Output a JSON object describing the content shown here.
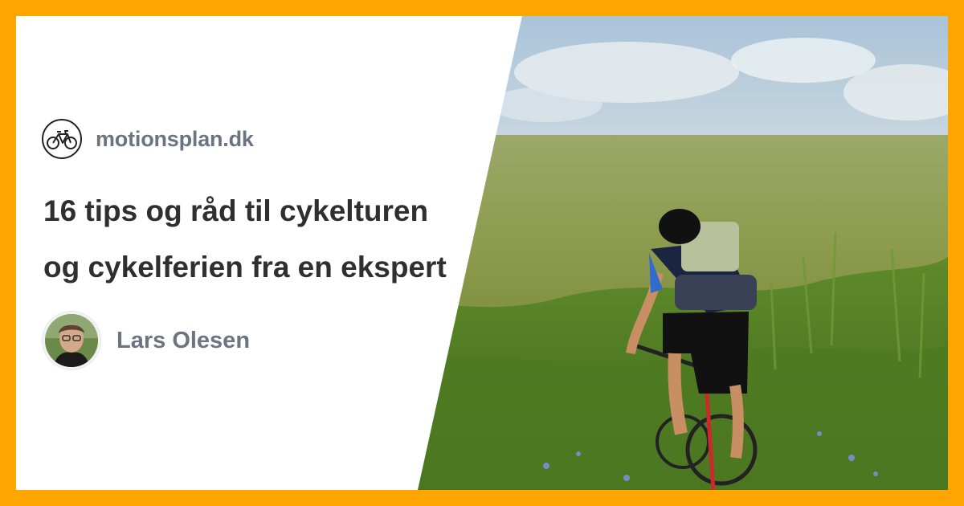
{
  "site": {
    "name": "motionsplan.dk",
    "logo_icon": "bicycle-icon"
  },
  "article": {
    "title_lines": [
      "16 tips og råd til cykelturen",
      "og cykelferien fra en ekspert"
    ]
  },
  "author": {
    "name": "Lars Olesen",
    "avatar_icon": "author-portrait"
  },
  "colors": {
    "border": "#ffa500",
    "brand_text": "#6b7480",
    "title_text": "#2f2f2f"
  }
}
